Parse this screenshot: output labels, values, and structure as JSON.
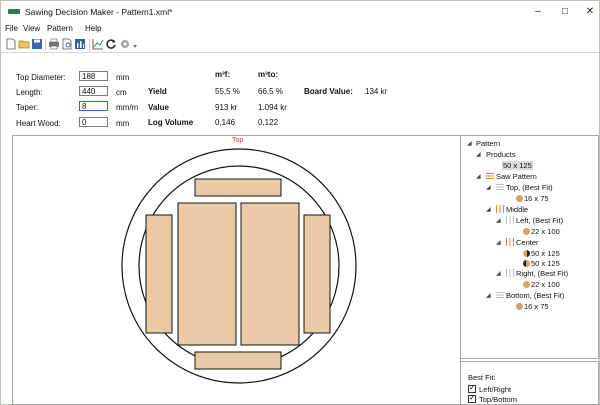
{
  "window": {
    "title": "Sawing Decision Maker - Pattern1.xml*",
    "minimize": "–",
    "maximize": "□",
    "close": "✕"
  },
  "menu": {
    "file": "File",
    "view": "View",
    "pattern": "Pattern",
    "help": "Help"
  },
  "params": {
    "top_diameter": {
      "label": "Top Diameter:",
      "value": "188",
      "unit": "mm"
    },
    "length": {
      "label": "Length:",
      "value": "440",
      "unit": "cm"
    },
    "taper": {
      "label": "Taper:",
      "value": "8",
      "unit": "mm/m"
    },
    "heart_wood": {
      "label": "Heart Wood:",
      "value": "0",
      "unit": "mm"
    }
  },
  "results": {
    "col1_head": "m³f:",
    "col2_head": "m³to:",
    "yield": {
      "label": "Yield",
      "f": "55,5 %",
      "to": "66,5 %"
    },
    "value": {
      "label": "Value",
      "f": "913 kr",
      "to": "1.094 kr"
    },
    "log_volume": {
      "label": "Log Volume",
      "f": "0,146",
      "to": "0,122"
    },
    "board_value": {
      "label": "Board Value:",
      "value": "134 kr"
    }
  },
  "canvas": {
    "top_label": "Top"
  },
  "tree": {
    "pattern": "Pattern",
    "products": "Products",
    "product_1": "50 x 125",
    "saw_pattern": "Saw Pattern",
    "top": "Top, (Best Fit)",
    "top_board": "16 x 75",
    "middle": "Middle",
    "left": "Left, (Best Fit)",
    "left_board": "22 x 100",
    "center": "Center",
    "center_board_1": "50 x 125",
    "center_board_2": "50 x 125",
    "right": "Right, (Best Fit)",
    "right_board": "22 x 100",
    "bottom": "Bottom, (Best Fit)",
    "bottom_board": "16 x 75"
  },
  "best_fit": {
    "title": "Best Fit:",
    "left_right": "Left/Right",
    "top_bottom": "Top/Bottom"
  },
  "colors": {
    "wood": "#eacaa6",
    "wood_dot": "#d9a06b",
    "top_label": "#d03a2e",
    "input_focus": "#2a6ad8"
  }
}
